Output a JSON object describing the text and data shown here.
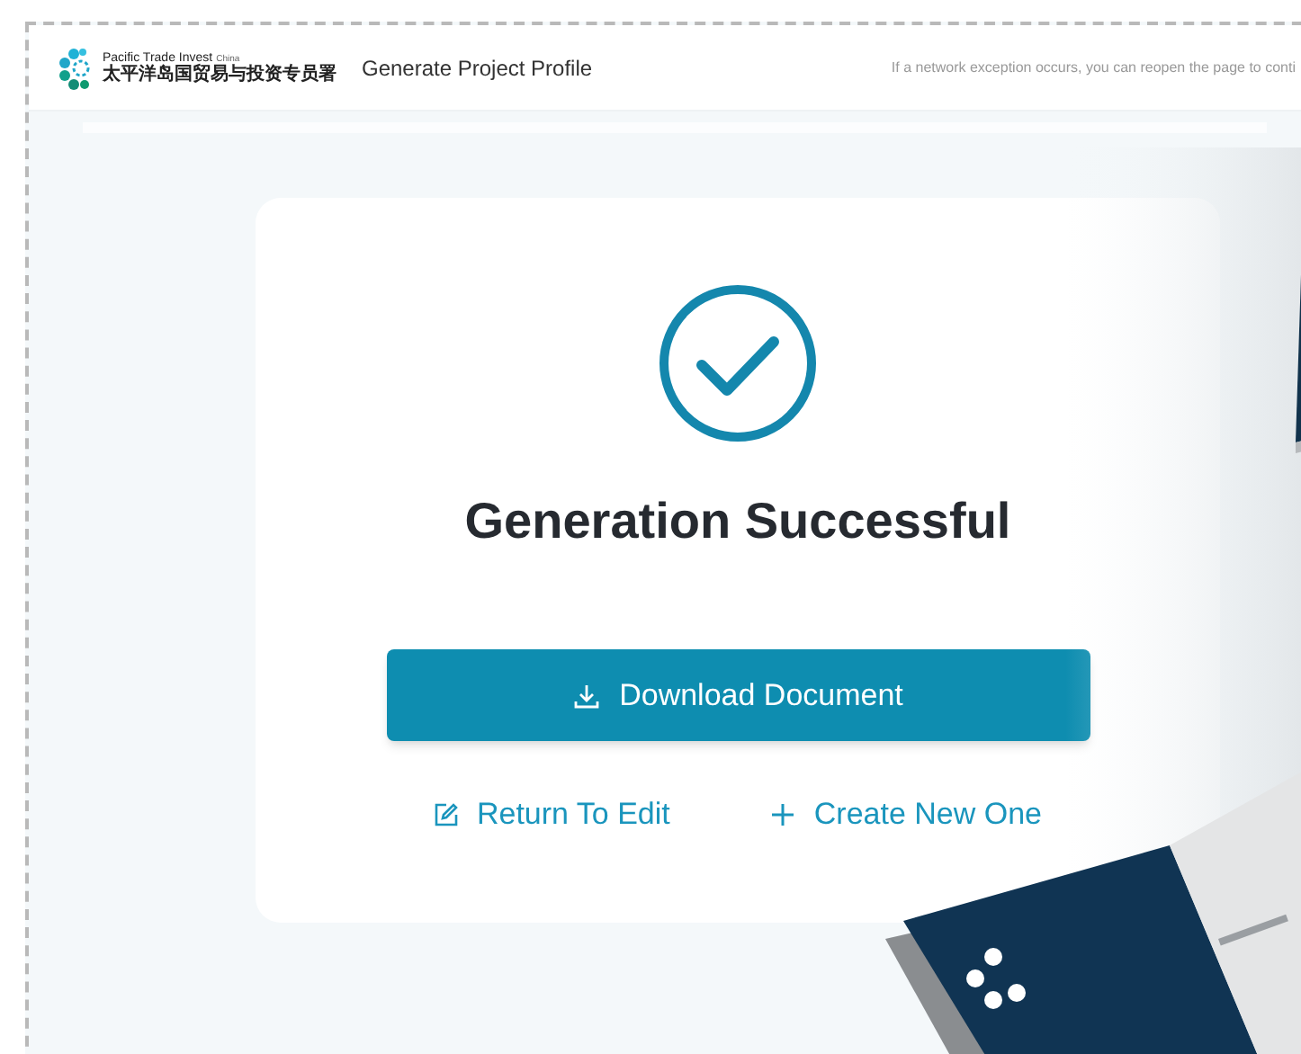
{
  "header": {
    "logo": {
      "name": "Pacific Trade Invest",
      "region": "China",
      "chinese": "太平洋岛国贸易与投资专员署"
    },
    "title": "Generate Project Profile",
    "notice": "If a network exception occurs, you can reopen the page to conti"
  },
  "result": {
    "title": "Generation Successful",
    "primary_button": "Download Document",
    "links": [
      {
        "kind": "edit",
        "label": "Return To Edit"
      },
      {
        "kind": "create",
        "label": "Create New One"
      }
    ]
  }
}
